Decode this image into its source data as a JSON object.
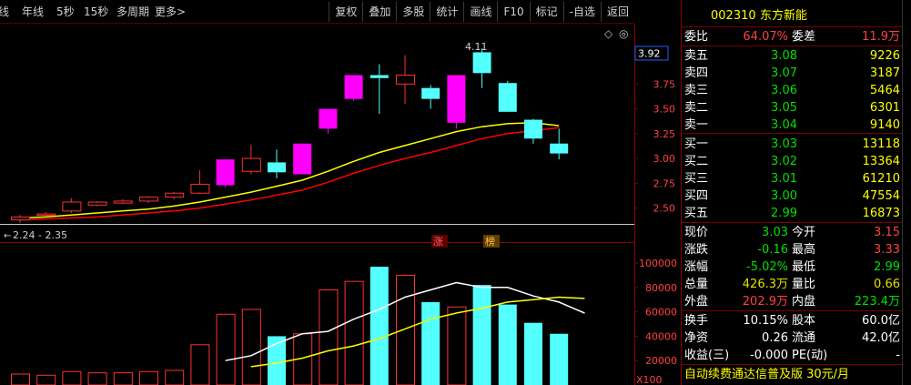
{
  "topbar": {
    "periods": [
      "线",
      "年线",
      "5秒",
      "15秒",
      "多周期",
      "更多>"
    ],
    "tools": [
      "复权",
      "叠加",
      "多股",
      "统计",
      "画线",
      "F10",
      "标记",
      "-自选",
      "返回"
    ]
  },
  "chart_data": [
    {
      "type": "candlestick",
      "title": "",
      "yticks": [
        "3.75",
        "3.50",
        "3.25",
        "3.00",
        "2.75",
        "2.50"
      ],
      "ylim": [
        2.34,
        4.23
      ],
      "current_price_label": "3.92",
      "high_annotation": "4.11",
      "low_annotation": "2.24 - 2.35",
      "candles": [
        {
          "o": 2.38,
          "c": 2.41,
          "h": 2.43,
          "l": 2.35
        },
        {
          "o": 2.44,
          "c": 2.44,
          "h": 2.46,
          "l": 2.42
        },
        {
          "o": 2.47,
          "c": 2.56,
          "h": 2.6,
          "l": 2.45
        },
        {
          "o": 2.53,
          "c": 2.56,
          "h": 2.57,
          "l": 2.52
        },
        {
          "o": 2.55,
          "c": 2.57,
          "h": 2.59,
          "l": 2.54
        },
        {
          "o": 2.57,
          "c": 2.61,
          "h": 2.62,
          "l": 2.55
        },
        {
          "o": 2.61,
          "c": 2.65,
          "h": 2.66,
          "l": 2.59
        },
        {
          "o": 2.65,
          "c": 2.74,
          "h": 2.88,
          "l": 2.64
        },
        {
          "o": 2.73,
          "c": 2.99,
          "h": 2.99,
          "l": 2.71
        },
        {
          "o": 2.87,
          "c": 3.0,
          "h": 3.14,
          "l": 2.84
        },
        {
          "o": 2.96,
          "c": 2.86,
          "h": 3.09,
          "l": 2.8
        },
        {
          "o": 2.84,
          "c": 3.15,
          "h": 3.15,
          "l": 2.84
        },
        {
          "o": 3.3,
          "c": 3.5,
          "h": 3.5,
          "l": 3.25
        },
        {
          "o": 3.6,
          "c": 3.84,
          "h": 3.84,
          "l": 3.58
        },
        {
          "o": 3.84,
          "c": 3.81,
          "h": 3.95,
          "l": 3.45
        },
        {
          "o": 3.75,
          "c": 3.84,
          "h": 4.04,
          "l": 3.55
        },
        {
          "o": 3.71,
          "c": 3.6,
          "h": 3.74,
          "l": 3.5
        },
        {
          "o": 3.36,
          "c": 3.84,
          "h": 3.84,
          "l": 3.3
        },
        {
          "o": 4.07,
          "c": 3.86,
          "h": 4.11,
          "l": 3.71
        },
        {
          "o": 3.76,
          "c": 3.47,
          "h": 3.78,
          "l": 3.47
        },
        {
          "o": 3.39,
          "c": 3.2,
          "h": 3.4,
          "l": 3.15
        },
        {
          "o": 3.15,
          "c": 3.05,
          "h": 3.3,
          "l": 2.99
        }
      ],
      "ma_yellow": [
        2.4,
        2.41,
        2.43,
        2.45,
        2.47,
        2.49,
        2.52,
        2.56,
        2.61,
        2.66,
        2.72,
        2.78,
        2.87,
        2.97,
        3.06,
        3.13,
        3.2,
        3.27,
        3.32,
        3.35,
        3.36,
        3.33
      ],
      "ma_red": [
        2.38,
        2.39,
        2.4,
        2.41,
        2.43,
        2.45,
        2.47,
        2.5,
        2.54,
        2.58,
        2.63,
        2.68,
        2.76,
        2.85,
        2.93,
        3.0,
        3.06,
        3.13,
        3.2,
        3.25,
        3.28,
        3.31
      ],
      "markers": [
        "涨",
        "榜"
      ]
    },
    {
      "type": "bar",
      "title": "",
      "unit": "X100",
      "yticks": [
        "100000",
        "80000",
        "60000",
        "40000",
        "20000"
      ],
      "ylim": [
        0,
        106000
      ],
      "volumes": [
        9000,
        8000,
        11000,
        10000,
        10000,
        11000,
        12000,
        33000,
        58000,
        62000,
        40000,
        42000,
        78000,
        85000,
        97000,
        90000,
        68000,
        64000,
        82000,
        66000,
        51000,
        42000
      ],
      "ma_white": [
        null,
        null,
        null,
        null,
        null,
        null,
        null,
        null,
        20000,
        24000,
        34000,
        42000,
        44000,
        54000,
        62000,
        72000,
        78000,
        84000,
        80000,
        80000,
        73000,
        68000,
        59000
      ],
      "ma_yellow": [
        null,
        null,
        null,
        null,
        null,
        null,
        null,
        null,
        null,
        15000,
        18000,
        22000,
        28000,
        32000,
        38000,
        46000,
        54000,
        59000,
        63000,
        68000,
        70000,
        72000,
        71000
      ]
    }
  ],
  "quote": {
    "code": "002310",
    "name": "东方新能",
    "webi_label": "委比",
    "webi_value": "64.07%",
    "weicha_label": "委差",
    "weicha_value": "11.9万",
    "asks": [
      {
        "label": "卖五",
        "price": "3.08",
        "vol": "9226"
      },
      {
        "label": "卖四",
        "price": "3.07",
        "vol": "3187"
      },
      {
        "label": "卖三",
        "price": "3.06",
        "vol": "5464"
      },
      {
        "label": "卖二",
        "price": "3.05",
        "vol": "6301"
      },
      {
        "label": "卖一",
        "price": "3.04",
        "vol": "9140"
      }
    ],
    "bids": [
      {
        "label": "买一",
        "price": "3.03",
        "vol": "13118"
      },
      {
        "label": "买二",
        "price": "3.02",
        "vol": "13364"
      },
      {
        "label": "买三",
        "price": "3.01",
        "vol": "61210"
      },
      {
        "label": "买四",
        "price": "3.00",
        "vol": "47554"
      },
      {
        "label": "买五",
        "price": "2.99",
        "vol": "16873"
      }
    ],
    "stats1": [
      {
        "l1": "现价",
        "v1": "3.03",
        "l2": "今开",
        "v2": "3.15",
        "c1": "#00e000",
        "c2": "#ff4040"
      },
      {
        "l1": "涨跌",
        "v1": "-0.16",
        "l2": "最高",
        "v2": "3.33",
        "c1": "#00e000",
        "c2": "#ff4040"
      },
      {
        "l1": "涨幅",
        "v1": "-5.02%",
        "l2": "最低",
        "v2": "2.99",
        "c1": "#00e000",
        "c2": "#00e000"
      },
      {
        "l1": "总量",
        "v1": "426.3万",
        "l2": "量比",
        "v2": "0.66",
        "c1": "#e0e000",
        "c2": "#e0e000"
      },
      {
        "l1": "外盘",
        "v1": "202.9万",
        "l2": "内盘",
        "v2": "223.4万",
        "c1": "#ff4040",
        "c2": "#00e000"
      }
    ],
    "stats2": [
      {
        "l1": "换手",
        "v1": "10.15%",
        "l2": "股本",
        "v2": "60.0亿"
      },
      {
        "l1": "净资",
        "v1": "0.26",
        "l2": "流通",
        "v2": "42.0亿"
      },
      {
        "l1": "收益(三)",
        "v1": "-0.000",
        "l2": "PE(动)",
        "v2": "-"
      }
    ],
    "ad": "自动续费通达信普及版 30元/月"
  },
  "colors": {
    "up": "#ff3232",
    "down": "#54ffff",
    "magenta": "#ff00ff",
    "ma1": "#ffff00",
    "ma2": "#ff0000",
    "vol_ma1": "#ffffff",
    "vol_ma2": "#ffff00"
  }
}
